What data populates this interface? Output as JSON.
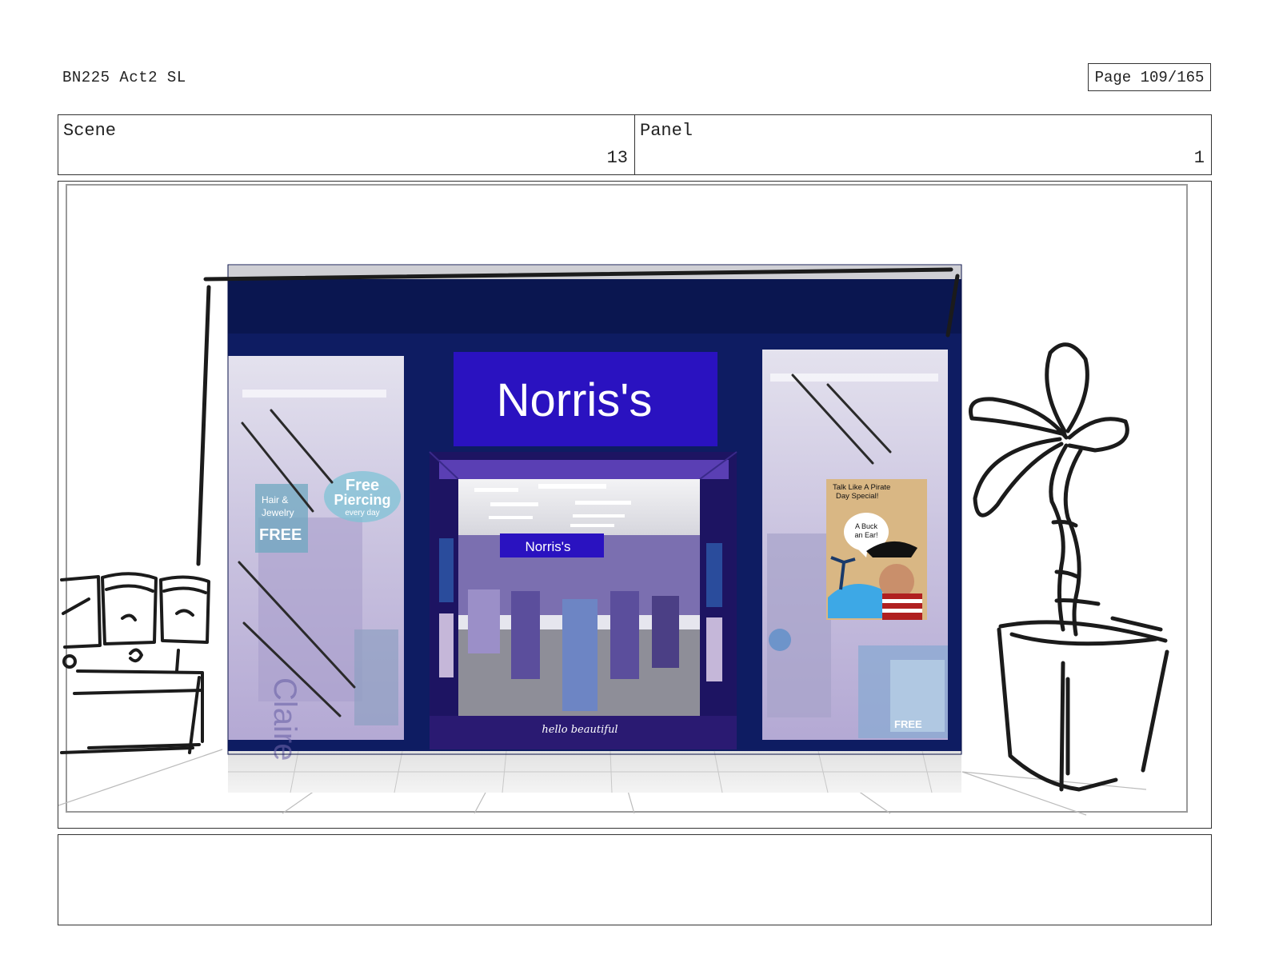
{
  "header": {
    "doc_title": "BN225 Act2 SL",
    "page_label": "Page 109/165"
  },
  "info": {
    "scene_label": "Scene",
    "scene_value": "13",
    "panel_label": "Panel",
    "panel_value": "1"
  },
  "panel": {
    "store_sign": "Norris's",
    "inner_sign": "Norris's",
    "window_promo_line1": "Free",
    "window_promo_line2": "Piercing",
    "window_promo_line3": "every day",
    "window_card_line1": "Hair &",
    "window_card_line2": "Jewelry",
    "window_card_line3": "FREE",
    "poster_line1": "Talk Like  A Pirate",
    "poster_line2": "Day Special!",
    "poster_bubble_line1": "A Buck",
    "poster_bubble_line2": "an Ear!",
    "mat_text": "hello beautiful",
    "right_window_badge": "FREE",
    "brand_color": "#2a12c0",
    "facade_color": "#0c1a5e"
  },
  "notes": {
    "text": ""
  }
}
